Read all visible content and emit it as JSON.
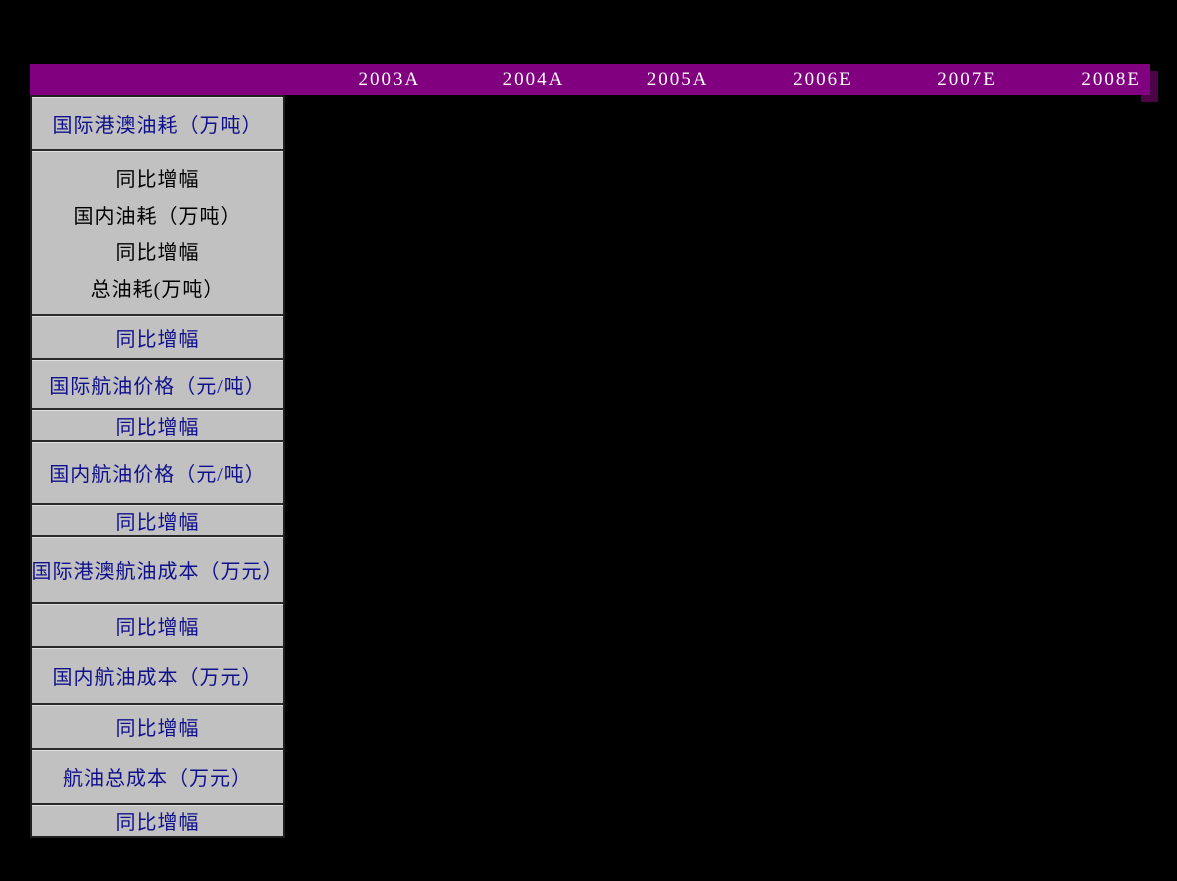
{
  "document": {
    "description": "Jet-fuel cost forecast table from a Chinese research report; data cells are blank/black, only headers visible"
  },
  "header": {
    "years": [
      "2003A",
      "2004A",
      "2005A",
      "2006E",
      "2007E",
      "2008E"
    ]
  },
  "rows": [
    {
      "label": "国际港澳油耗（万吨）",
      "text_color": "blue"
    },
    {
      "lines": [
        "同比增幅",
        "国内油耗（万吨）",
        "同比增幅",
        "总油耗(万吨）"
      ],
      "text_color": "black"
    },
    {
      "label": "同比增幅",
      "text_color": "blue"
    },
    {
      "label": "国际航油价格（元/吨）",
      "text_color": "blue"
    },
    {
      "label": "同比增幅",
      "text_color": "blue"
    },
    {
      "label": "国内航油价格（元/吨）",
      "text_color": "blue"
    },
    {
      "label": "同比增幅",
      "text_color": "blue"
    },
    {
      "label": "国际港澳航油成本（万元）",
      "text_color": "blue"
    },
    {
      "label": "同比增幅",
      "text_color": "blue"
    },
    {
      "label": "国内航油成本（万元）",
      "text_color": "blue"
    },
    {
      "label": "同比增幅",
      "text_color": "blue"
    },
    {
      "label": "航油总成本（万元）",
      "text_color": "blue"
    },
    {
      "label": "同比增幅",
      "text_color": "blue"
    }
  ],
  "chart_data": {
    "type": "table",
    "title": "",
    "columns": [
      "",
      "2003A",
      "2004A",
      "2005A",
      "2006E",
      "2007E",
      "2008E"
    ],
    "row_labels": [
      "国际港澳油耗（万吨）",
      "同比增幅",
      "国内油耗（万吨）",
      "同比增幅",
      "总油耗(万吨）",
      "同比增幅",
      "国际航油价格（元/吨）",
      "同比增幅",
      "国内航油价格（元/吨）",
      "同比增幅",
      "国际港澳航油成本（万元）",
      "同比增幅",
      "国内航油成本（万元）",
      "同比增幅",
      "航油总成本（万元）",
      "同比增幅"
    ],
    "values": "not visible (data area rendered black/empty)"
  },
  "colors": {
    "background": "#000000",
    "header_bg": "#800080",
    "header_shadow": "#4c0449",
    "header_text": "#ffffff",
    "label_bg": "#c1c1c1",
    "label_border": "#1f1f1f",
    "label_text_blue": "#10108c",
    "label_text_black": "#000000"
  }
}
